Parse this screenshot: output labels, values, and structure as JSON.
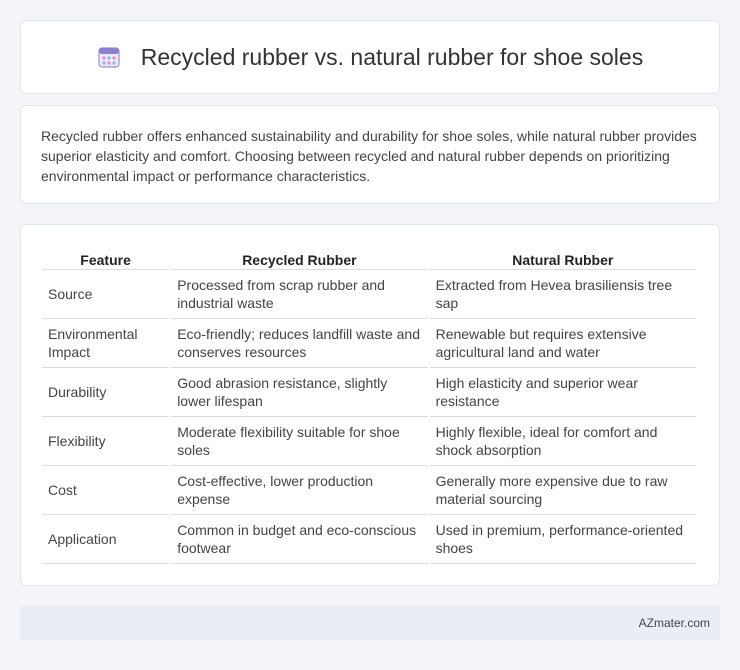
{
  "header": {
    "icon": "calendar-icon",
    "title": "Recycled rubber vs. natural rubber for shoe soles"
  },
  "summary": {
    "text": "Recycled rubber offers enhanced sustainability and durability for shoe soles, while natural rubber provides superior elasticity and comfort. Choosing between recycled and natural rubber depends on prioritizing environmental impact or performance characteristics."
  },
  "table": {
    "headers": [
      "Feature",
      "Recycled Rubber",
      "Natural Rubber"
    ],
    "rows": [
      [
        "Source",
        "Processed from scrap rubber and industrial waste",
        "Extracted from Hevea brasiliensis tree sap"
      ],
      [
        "Environmental Impact",
        "Eco-friendly; reduces landfill waste and conserves resources",
        "Renewable but requires extensive agricultural land and water"
      ],
      [
        "Durability",
        "Good abrasion resistance, slightly lower lifespan",
        "High elasticity and superior wear resistance"
      ],
      [
        "Flexibility",
        "Moderate flexibility suitable for shoe soles",
        "Highly flexible, ideal for comfort and shock absorption"
      ],
      [
        "Cost",
        "Cost-effective, lower production expense",
        "Generally more expensive due to raw material sourcing"
      ],
      [
        "Application",
        "Common in budget and eco-conscious footwear",
        "Used in premium, performance-oriented shoes"
      ]
    ]
  },
  "footer": {
    "brand": "AZmater.com"
  }
}
